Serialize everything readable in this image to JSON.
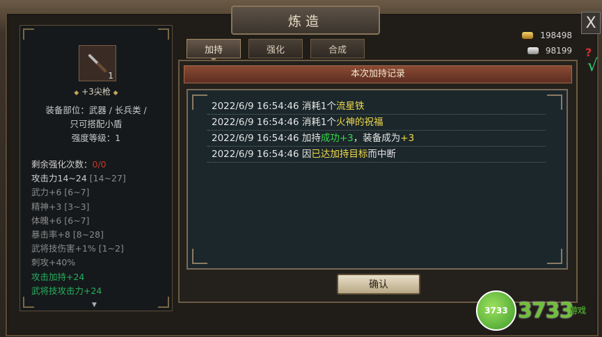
{
  "window": {
    "title": "炼造",
    "close_label": "X"
  },
  "item": {
    "count": "1",
    "name": "+3尖枪",
    "desc_lines": [
      "装备部位：武器 / 长兵类 /",
      "只可搭配小盾",
      "强度等级：1"
    ],
    "stats": [
      {
        "label": "剩余强化次数：",
        "value": "0/0"
      },
      {
        "label": "攻击力14~24",
        "value": "[14~27]"
      },
      {
        "label": "武力+6",
        "value": "[6~7]"
      },
      {
        "label": "精神+3",
        "value": "[3~3]"
      },
      {
        "label": "体魄+6",
        "value": "[6~7]"
      },
      {
        "label": "暴击率+8",
        "value": "[8~28]"
      },
      {
        "label": "武将技伤害+1%",
        "value": "[1~2]"
      },
      {
        "label": "刺攻+40%"
      },
      {
        "label": "攻击加持+24"
      },
      {
        "label": "武将技攻击力+24"
      }
    ]
  },
  "tabs": [
    {
      "label": "加持",
      "active": true
    },
    {
      "label": "强化",
      "active": false
    },
    {
      "label": "合成",
      "active": false
    }
  ],
  "currency": {
    "gold": "198498",
    "silver": "98199"
  },
  "help_label": "?",
  "check_label": "√",
  "dialog": {
    "title": "本次加持记录",
    "records": [
      {
        "time": "2022/6/9 16:54:46",
        "a": "消耗1个",
        "b": "流星铁"
      },
      {
        "time": "2022/6/9 16:54:46",
        "a": "消耗1个",
        "b": "火神的祝福"
      },
      {
        "time": "2022/6/9 16:54:46",
        "a": "加持",
        "b": "成功+3",
        "c": "，装备成为",
        "d": "+3"
      },
      {
        "time": "2022/6/9 16:54:46",
        "a": "因",
        "b": "已达加持目标",
        "c": "而中断"
      }
    ],
    "confirm_label": "确认"
  },
  "watermark": {
    "badge": "3733",
    "text": "3733",
    "sub": "游戏"
  },
  "colors": {
    "highlight_yellow": "#f1d94b",
    "highlight_green": "#36d84a",
    "remaining_red": "#c0392b",
    "bonus_green": "#27ae60"
  }
}
